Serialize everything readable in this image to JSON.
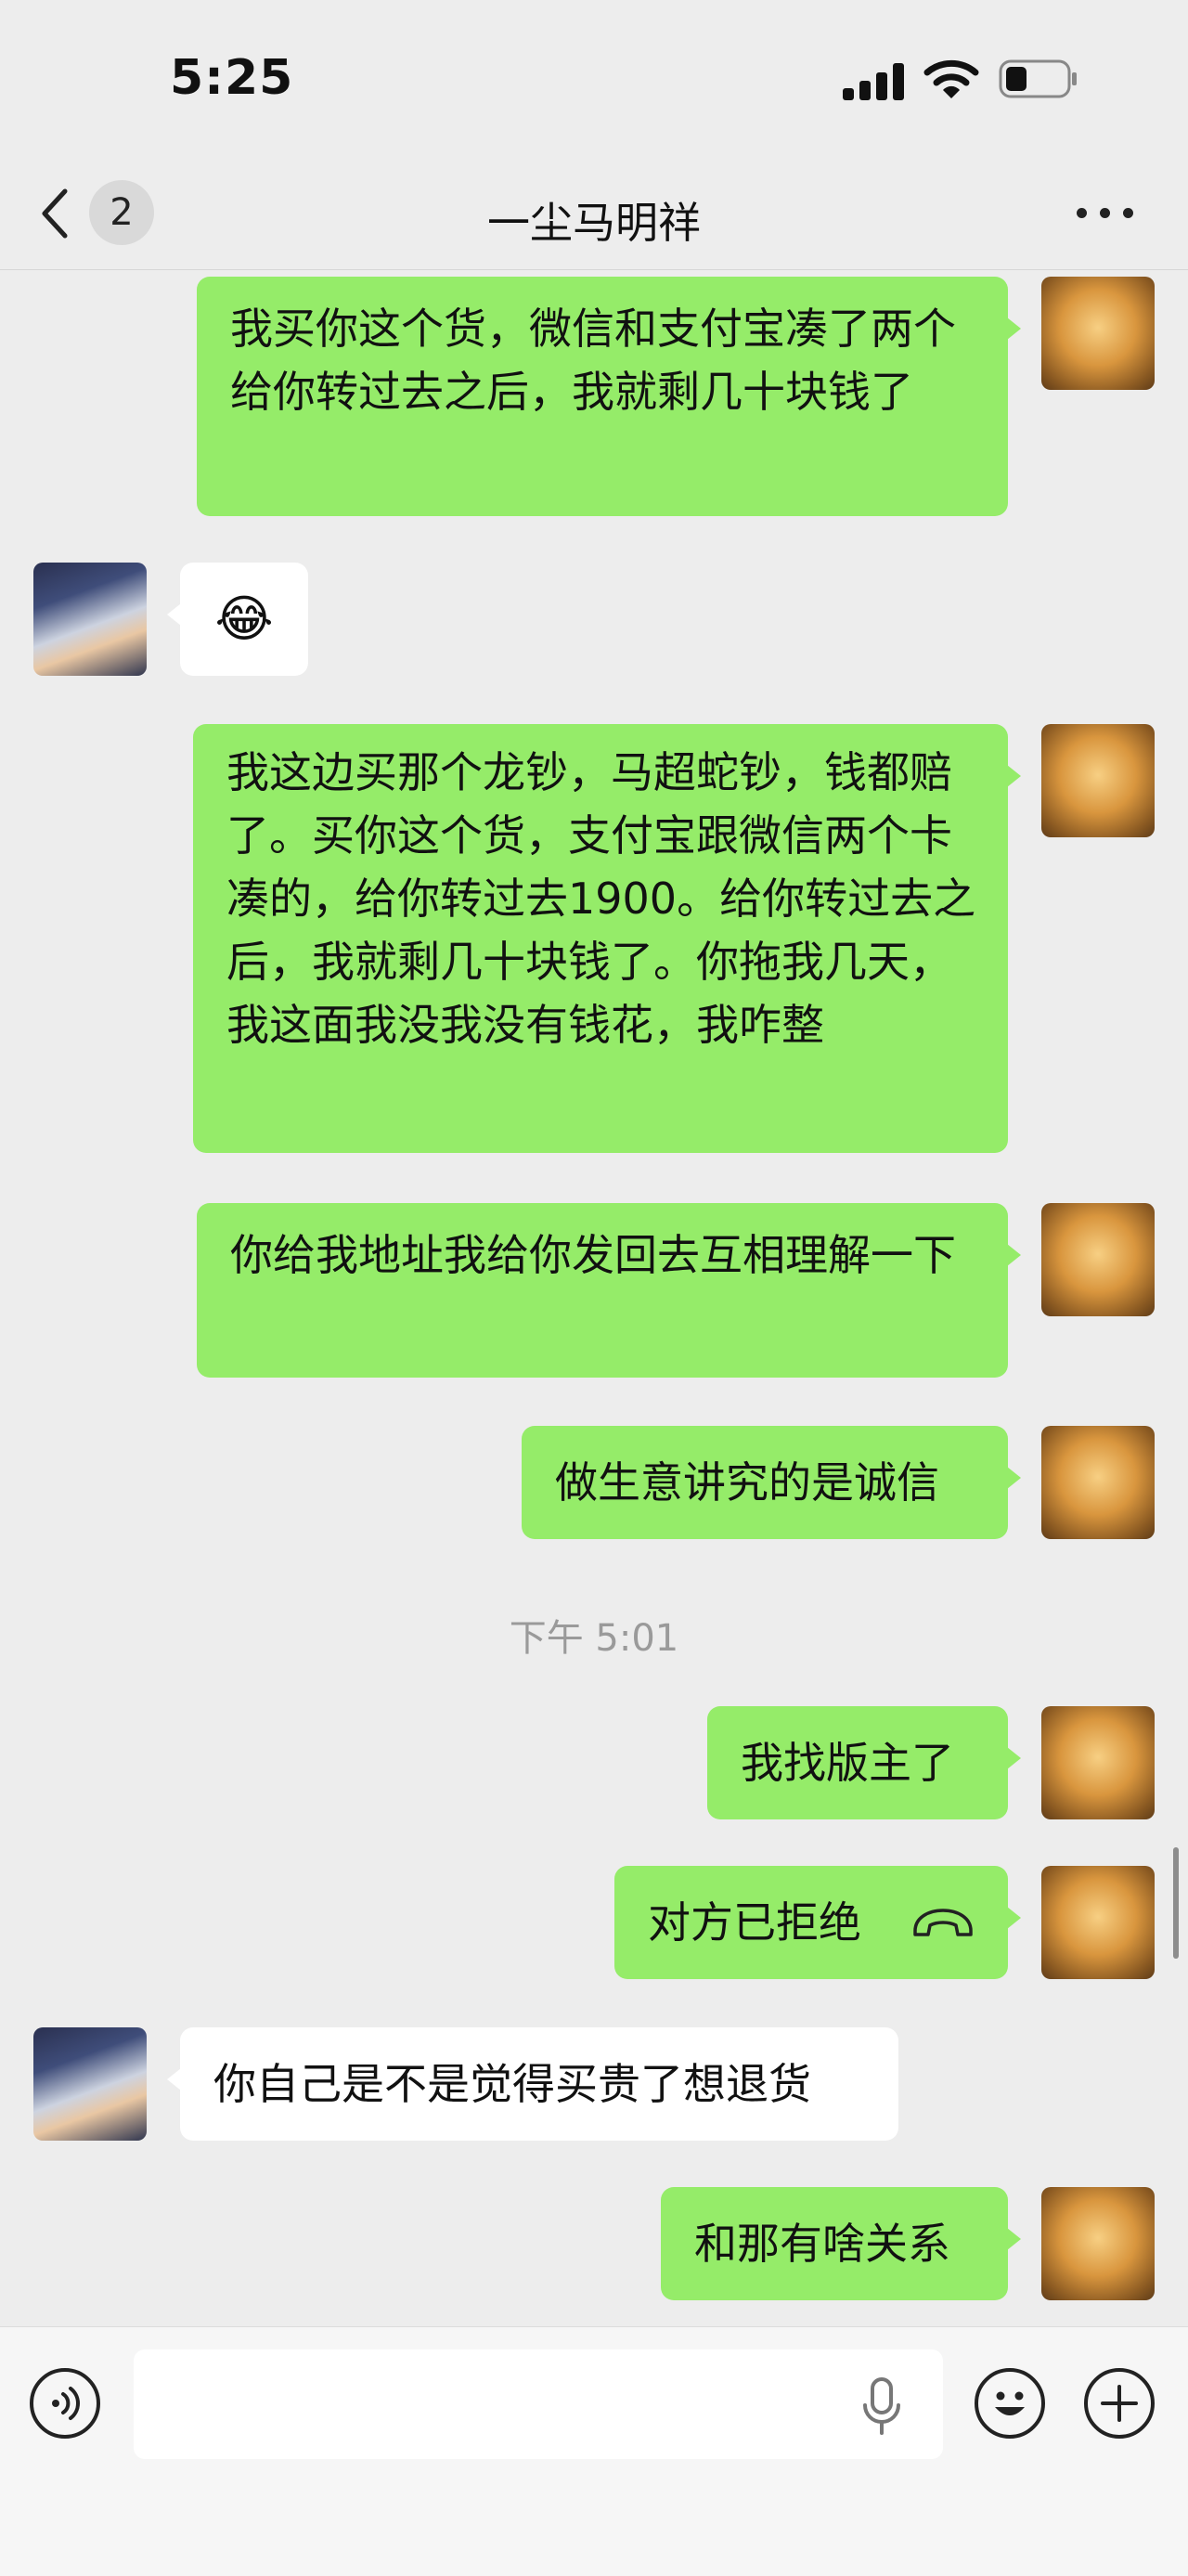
{
  "status_bar": {
    "time": "5:25"
  },
  "header": {
    "unread_count": "2",
    "title": "一尘马明祥"
  },
  "messages": [
    {
      "side": "me",
      "text": "我买你这个货，微信和支付宝凑了两个给你转过去之后，我就剩几十块钱了"
    },
    {
      "side": "them",
      "emoji": "😂"
    },
    {
      "side": "me",
      "text": "我这边买那个龙钞，马超蛇钞，钱都赔了。买你这个货，支付宝跟微信两个卡凑的，给你转过去1900。给你转过去之后，我就剩几十块钱了。你拖我几天，我这面我没我没有钱花，我咋整"
    },
    {
      "side": "me",
      "text": "你给我地址我给你发回去互相理解一下"
    },
    {
      "side": "me",
      "text": "做生意讲究的是诚信"
    },
    {
      "side": "me",
      "text": "我找版主了"
    },
    {
      "side": "me",
      "text": "对方已拒绝",
      "icon": "call-declined-icon"
    },
    {
      "side": "them",
      "text": "你自己是不是觉得买贵了想退货"
    },
    {
      "side": "me",
      "text": "和那有啥关系"
    }
  ],
  "timestamp": "下午 5:01",
  "colors": {
    "my_bubble": "#95ec69",
    "their_bubble": "#ffffff",
    "background": "#ededed"
  }
}
